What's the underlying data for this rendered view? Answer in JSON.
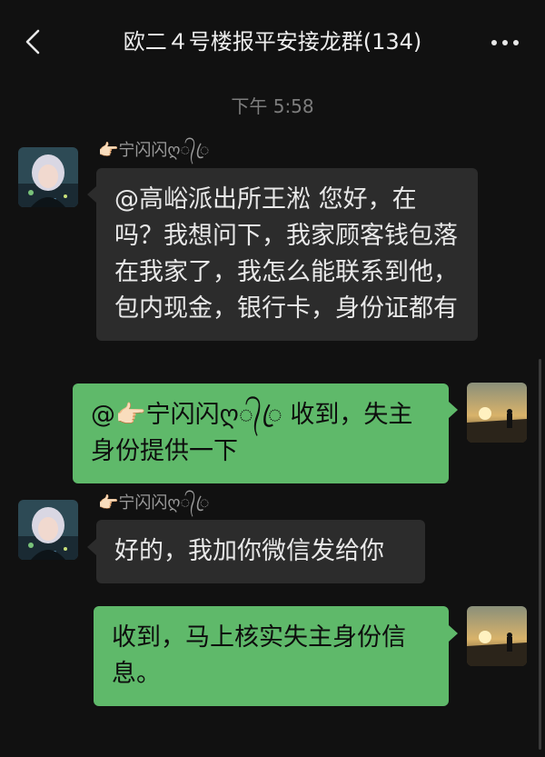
{
  "header": {
    "back_icon": "chevron-left-icon",
    "title": "欧二４号楼报平安接龙群(134)",
    "more_icon": "more-dots-icon"
  },
  "timestamp": "下午 5:58",
  "messages": [
    {
      "direction": "in",
      "nickname": "👉🏻宁闪闪ღ᭄ꦿ",
      "text": "@高峪派出所王淞 您好，在吗？我想问下，我家顾客钱包落在我家了，我怎么能联系到他，包内现金，银行卡，身份证都有"
    },
    {
      "direction": "out",
      "text": "@👉🏻宁闪闪ღ᭄ꦿ 收到，失主身份提供一下"
    },
    {
      "direction": "in",
      "nickname": "👉🏻宁闪闪ღ᭄ꦿ",
      "text": "好的，我加你微信发给你"
    },
    {
      "direction": "out",
      "text": "收到，马上核实失主身份信息。"
    }
  ],
  "colors": {
    "background": "#111111",
    "incoming_bubble": "#2c2c2c",
    "outgoing_bubble": "#5fb96a"
  }
}
